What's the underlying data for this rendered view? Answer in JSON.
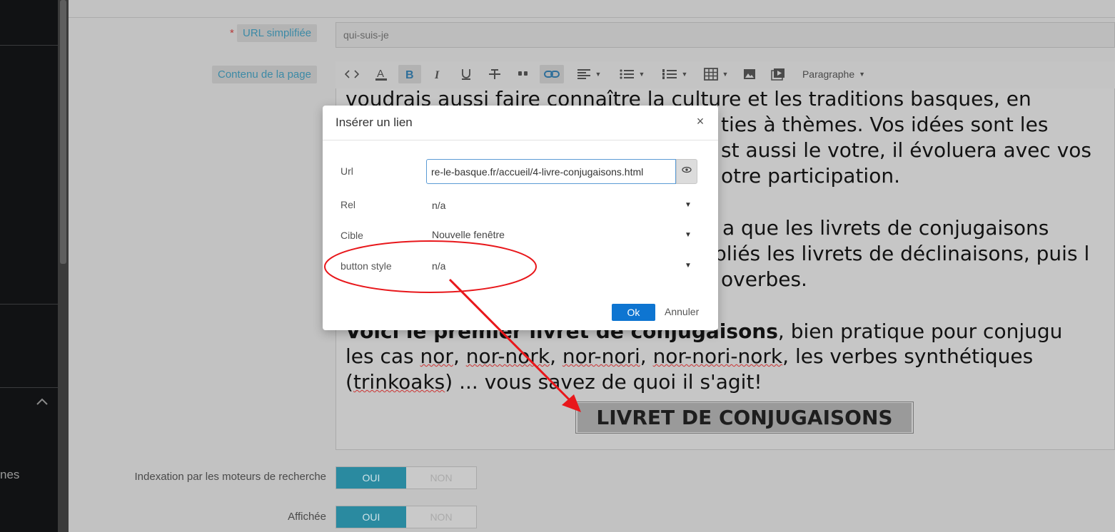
{
  "sidebar": {
    "partial_text": "nes"
  },
  "form": {
    "url_label": "URL simplifiée",
    "required_mark": "*",
    "url_value": "qui-suis-je",
    "content_label": "Contenu de la page",
    "toolbar": {
      "paragraph_label": "Paragraphe",
      "icons": [
        "source-code-icon",
        "text-color-icon",
        "bold-icon",
        "italic-icon",
        "underline-icon",
        "strikethrough-icon",
        "quote-icon",
        "link-icon",
        "align-icon",
        "bullet-list-icon",
        "numbered-list-icon",
        "table-icon",
        "image-icon",
        "media-icon"
      ]
    },
    "editor": {
      "line1": "voudrais aussi faire connaître la culture et les traditions basques, en",
      "line2": "ties à thèmes. Vos idées sont les",
      "line3": "st aussi le votre, il évoluera avec vos",
      "line4": "otre participation.",
      "line5": "a que les livrets de conjugaisons",
      "line6": "pliés les livrets de déclinaisons, puis l",
      "line7": "overbes.",
      "voici_bold": "Voici le premier livret de conjugaisons",
      "voici_rest": ", bien pratique pour conjugu",
      "line9_a": "les cas ",
      "line9_nor": "nor",
      "line9_b": ", ",
      "line9_nornork": "nor-nork",
      "line9_c": ", ",
      "line9_nornori": "nor-nori",
      "line9_d": ", ",
      "line9_nornorinork": "nor-nori-nork",
      "line9_e": ", les verbes synthétiques",
      "line10_a": "(",
      "line10_trinkoaks": "trinkoaks",
      "line10_b": ") ... vous savez de quoi il s'agit!",
      "livret_button": "LIVRET DE CONJUGAISONS"
    },
    "indexation_label": "Indexation par les moteurs de recherche",
    "displayed_label": "Affichée",
    "yes": "OUI",
    "no": "NON"
  },
  "modal": {
    "title": "Insérer un lien",
    "close": "×",
    "url_label": "Url",
    "url_value": "re-le-basque.fr/accueil/4-livre-conjugaisons.html",
    "rel_label": "Rel",
    "rel_value": "n/a",
    "target_label": "Cible",
    "target_value": "Nouvelle fenêtre",
    "button_style_label": "button style",
    "button_style_value": "n/a",
    "ok": "Ok",
    "cancel": "Annuler"
  },
  "colors": {
    "accent": "#0e75d1",
    "toggle_on": "#2a8aa0",
    "annotation": "#e8171b"
  }
}
